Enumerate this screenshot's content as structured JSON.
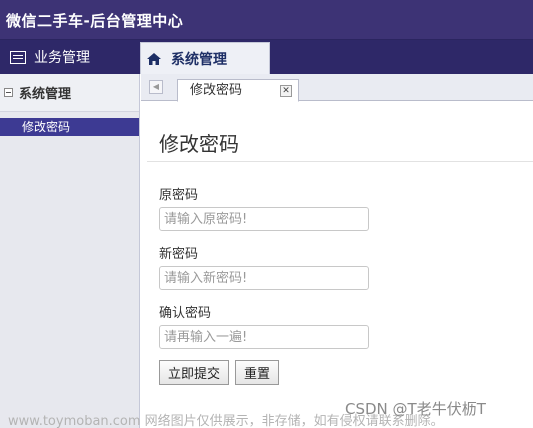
{
  "app": {
    "title": "微信二手车-后台管理中心"
  },
  "navbar": {
    "items": [
      {
        "label": "业务管理",
        "icon": "list-icon"
      },
      {
        "label": "系统管理",
        "icon": "home-icon",
        "active": true
      }
    ]
  },
  "sidebar": {
    "section": "系统管理",
    "items": [
      {
        "label": "修改密码",
        "selected": true
      }
    ]
  },
  "tabs": [
    {
      "label": "修改密码",
      "closable": true
    }
  ],
  "form": {
    "title": "修改密码",
    "fields": [
      {
        "label": "原密码",
        "placeholder": "请输入原密码!"
      },
      {
        "label": "新密码",
        "placeholder": "请输入新密码!"
      },
      {
        "label": "确认密码",
        "placeholder": "请再输入一遍!"
      }
    ],
    "submit_label": "立即提交",
    "reset_label": "重置"
  },
  "watermarks": {
    "left": "www.toymoban.com 网络图片仅供展示，非存储，如有侵权请联系删除。",
    "right": "CSDN @T老牛伏枥T"
  },
  "colors": {
    "header_bg": "#3d3375",
    "nav_bg": "#2e2868",
    "selected_item_bg": "#3d3a93"
  }
}
